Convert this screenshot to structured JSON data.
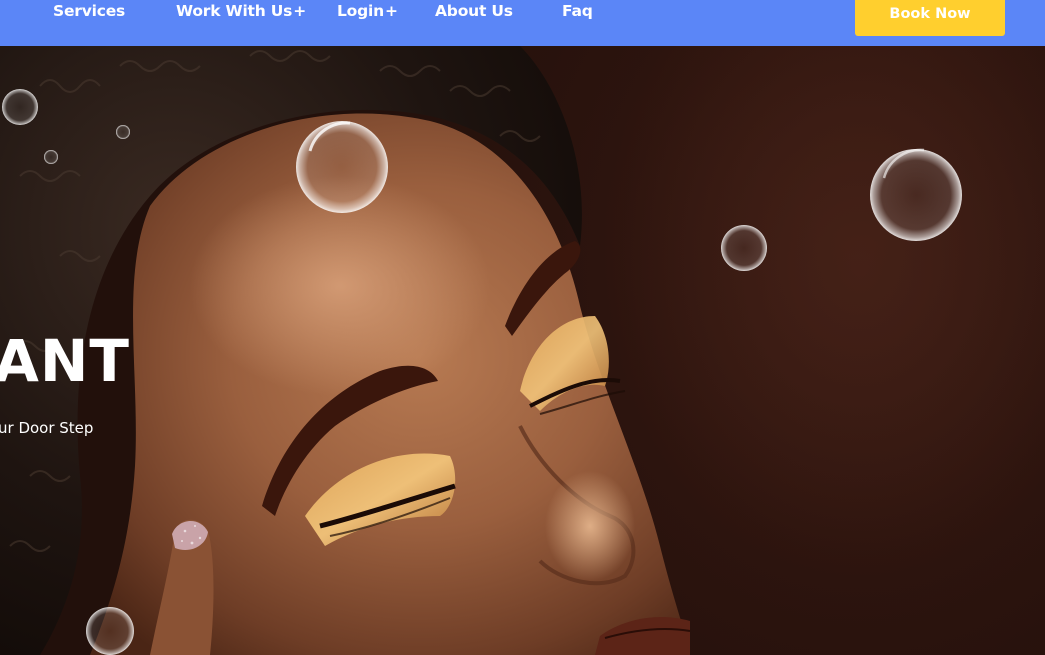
{
  "nav": {
    "items": [
      {
        "label": "Services",
        "suffix": ""
      },
      {
        "label": "Work With Us",
        "suffix": "+"
      },
      {
        "label": "Login",
        "suffix": "+"
      },
      {
        "label": "About Us",
        "suffix": ""
      },
      {
        "label": "Faq",
        "suffix": ""
      }
    ],
    "cta_label": "Book Now"
  },
  "hero": {
    "title": "ANT",
    "subtitle": "ur Door Step",
    "image_description_icon": "portrait-photo"
  },
  "colors": {
    "nav_bg": "#5b86f7",
    "cta_bg": "#ffcf2e",
    "hero_bg": "#2a130e",
    "text": "#ffffff"
  }
}
